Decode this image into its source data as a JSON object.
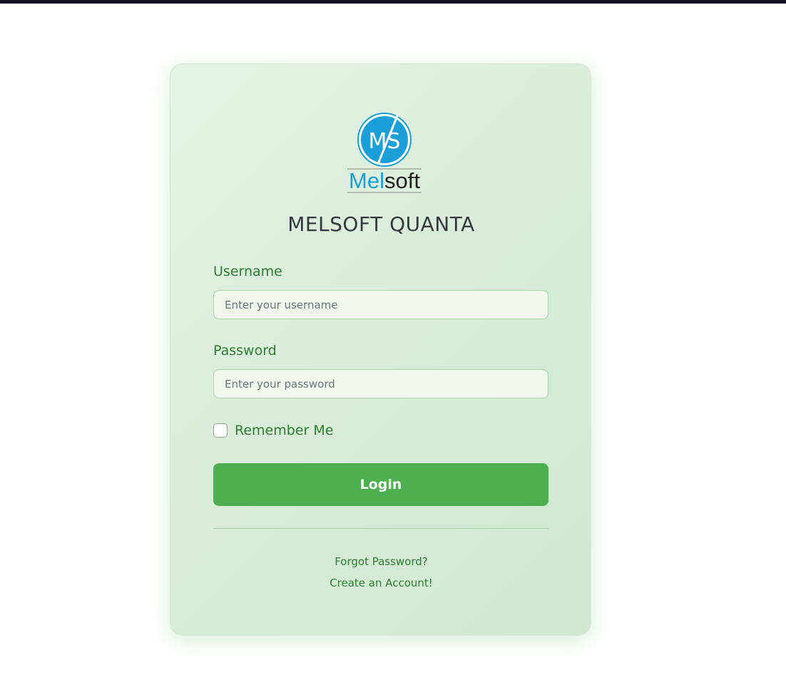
{
  "brand": {
    "logo_monogram": "MS",
    "logo_wordmark_part1": "Mel",
    "logo_wordmark_part2": "soft",
    "logo_colors": {
      "accent": "#1a9fd9",
      "dark": "#222222"
    },
    "app_title": "MELSOFT QUANTA"
  },
  "form": {
    "username_label": "Username",
    "username_placeholder": "Enter your username",
    "username_value": "",
    "password_label": "Password",
    "password_placeholder": "Enter your password",
    "password_value": "",
    "remember_label": "Remember Me",
    "remember_checked": false,
    "login_label": "Login"
  },
  "links": {
    "forgot_password": "Forgot Password?",
    "create_account": "Create an Account!"
  },
  "colors": {
    "primary": "#4caf50",
    "label_green": "#2e7d32",
    "title": "#343a40"
  }
}
